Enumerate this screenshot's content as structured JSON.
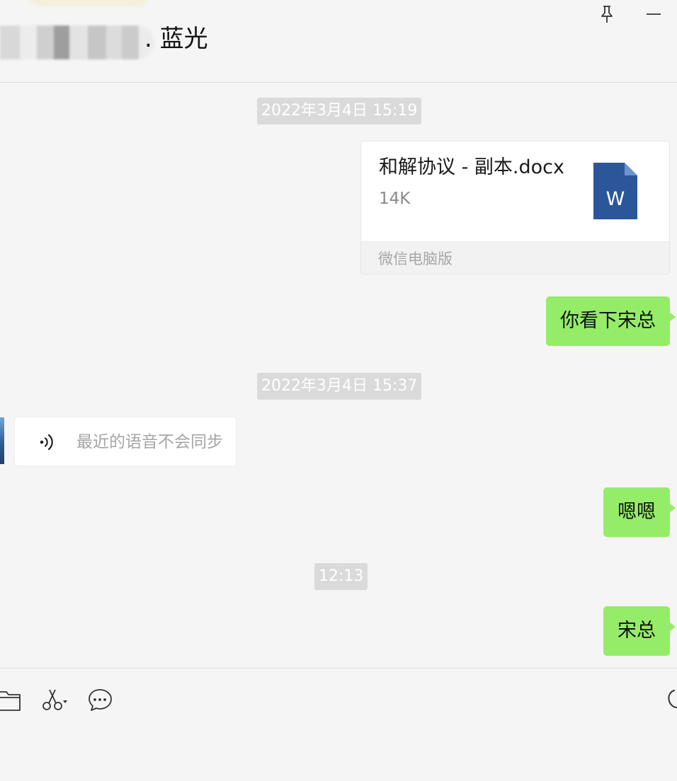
{
  "header": {
    "title": ". 蓝光",
    "pin_icon": "pin-icon",
    "minimize_icon": "minimize-icon"
  },
  "timestamps": [
    "2022年3月4日 15:19",
    "2022年3月4日 15:37",
    "12:13"
  ],
  "file_message": {
    "file_name": "和解协议 - 副本.docx",
    "file_size": "14K",
    "source": "微信电脑版",
    "icon": "word-document-icon",
    "icon_letter": "W",
    "icon_color": "#2b579a"
  },
  "messages": {
    "msg1": "你看下宋总",
    "msg2": "嗯嗯",
    "msg3": "宋总"
  },
  "voice_message": {
    "text": "最近的语音不会同步",
    "icon": "voice-wave-icon"
  },
  "toolbar": {
    "icons": [
      "folder-icon",
      "scissors-icon",
      "chat-bubble-icon",
      "phone-icon"
    ]
  },
  "colors": {
    "sent_bubble": "#95ec69",
    "background": "#f5f5f5",
    "timestamp_bg": "#dadada"
  }
}
